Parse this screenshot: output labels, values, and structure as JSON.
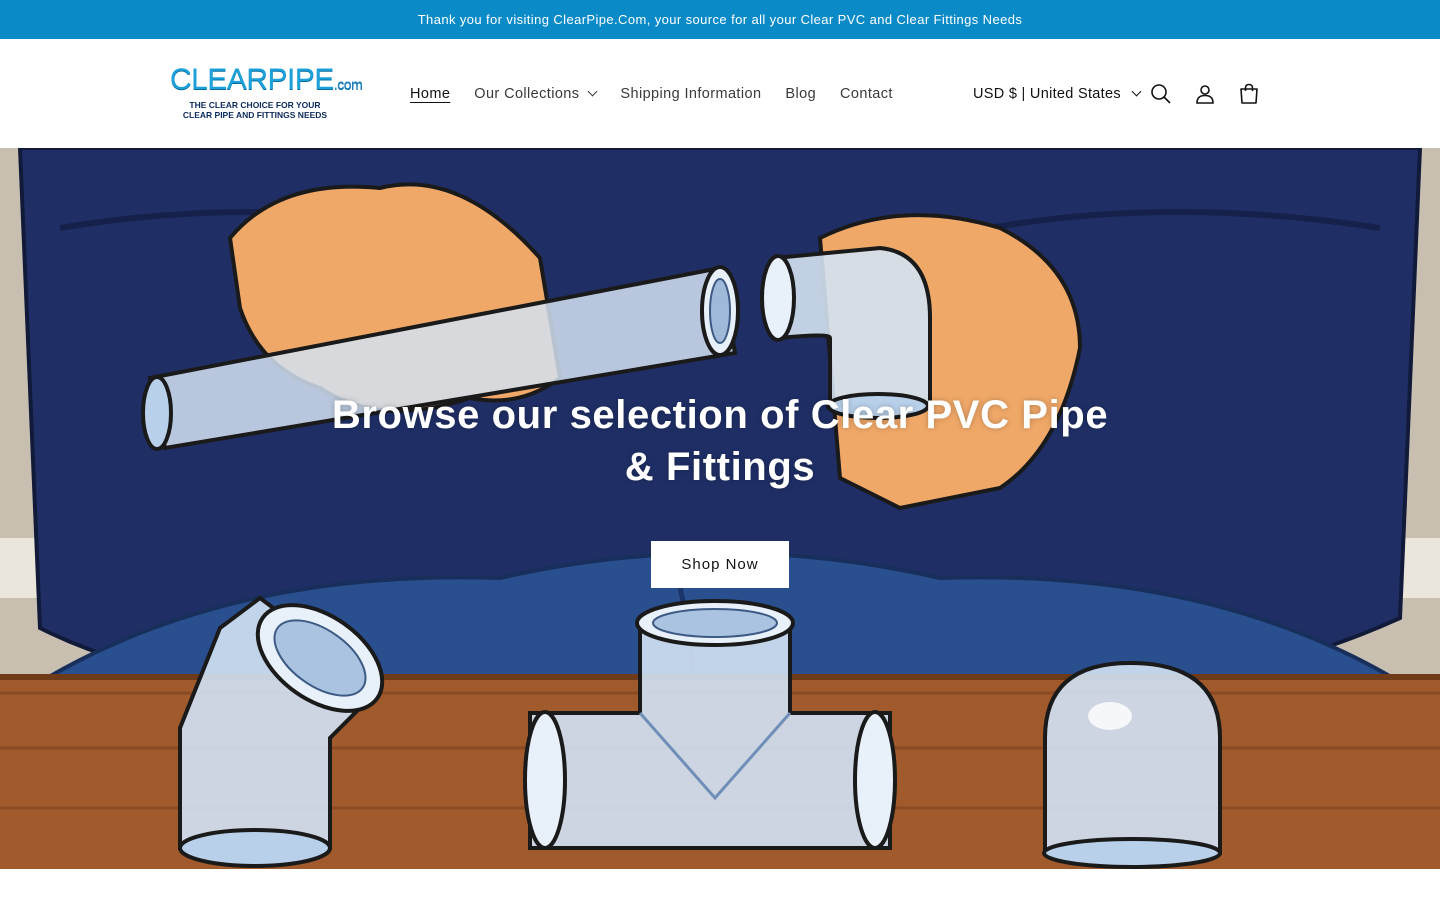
{
  "announcement": "Thank you for visiting ClearPipe.Com, your source for all your Clear PVC and Clear Fittings Needs",
  "logo": {
    "wordmark": "CLEARPIPE",
    "suffix": ".com",
    "tagline_line1": "THE CLEAR CHOICE FOR YOUR",
    "tagline_line2": "CLEAR PIPE AND FITTINGS NEEDS"
  },
  "nav": {
    "items": [
      {
        "label": "Home"
      },
      {
        "label": "Our Collections"
      },
      {
        "label": "Shipping Information"
      },
      {
        "label": "Blog"
      },
      {
        "label": "Contact"
      }
    ]
  },
  "country_selector": "USD $ | United States",
  "icons": [
    "search-icon",
    "account-icon",
    "cart-icon"
  ],
  "hero": {
    "title": "Browse our selection of Clear PVC Pipe & Fittings",
    "button": "Shop Now"
  },
  "colors": {
    "announcement_bg": "#0a8ac6",
    "shirt": "#1f2f66",
    "jeans": "#2a4f8f",
    "table": "#a05a2c",
    "wall": "#c9bfb0"
  }
}
